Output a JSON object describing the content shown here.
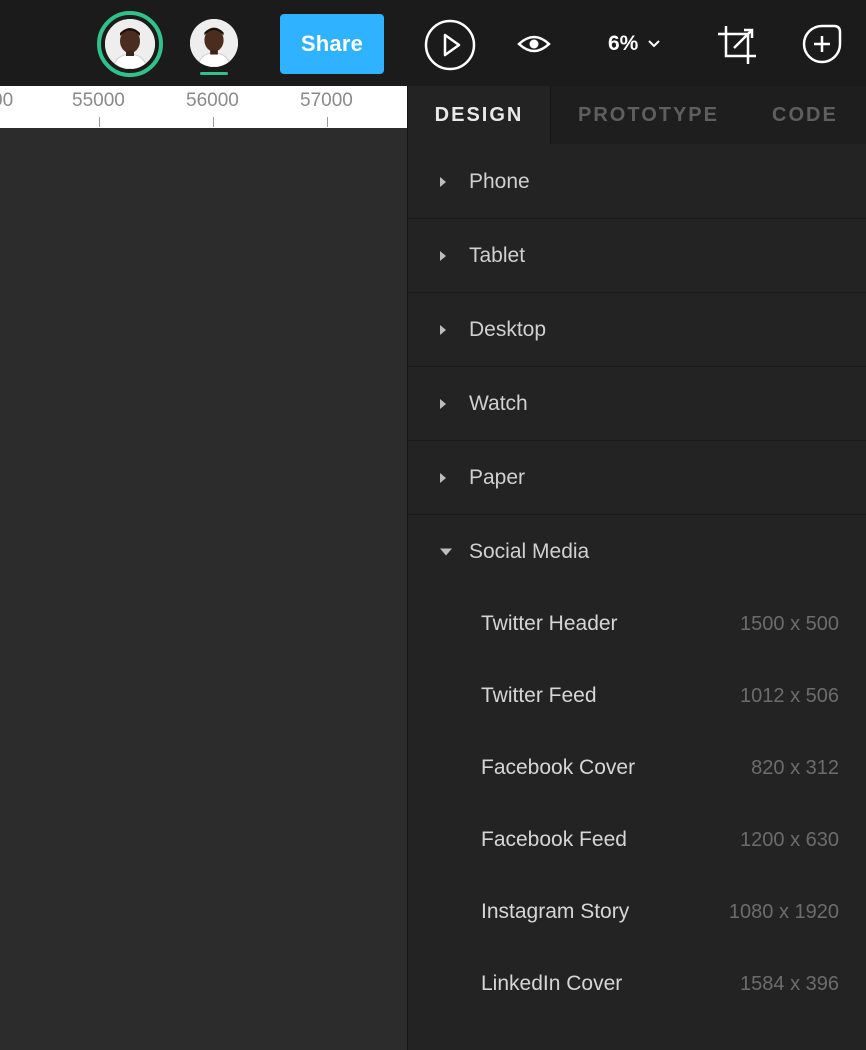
{
  "toolbar": {
    "share_label": "Share",
    "zoom_value": "6%",
    "accent_color": "#2fb2ff",
    "presence_color": "#2fc38b",
    "icons": [
      "user-avatar",
      "play-icon",
      "eye-icon",
      "chevron-down-icon",
      "crop-export-icon",
      "plus-circle-icon"
    ]
  },
  "ruler": {
    "partial_label": "00",
    "labels": [
      "55000",
      "56000",
      "57000"
    ]
  },
  "panel": {
    "tabs": [
      {
        "label": "DESIGN",
        "active": true
      },
      {
        "label": "PROTOTYPE",
        "active": false
      },
      {
        "label": "CODE",
        "active": false
      }
    ],
    "sections": [
      {
        "label": "Phone",
        "expanded": false
      },
      {
        "label": "Tablet",
        "expanded": false
      },
      {
        "label": "Desktop",
        "expanded": false
      },
      {
        "label": "Watch",
        "expanded": false
      },
      {
        "label": "Paper",
        "expanded": false
      },
      {
        "label": "Social Media",
        "expanded": true
      }
    ],
    "social_presets": [
      {
        "name": "Twitter Header",
        "size": "1500 x 500"
      },
      {
        "name": "Twitter Feed",
        "size": "1012 x 506"
      },
      {
        "name": "Facebook Cover",
        "size": "820 x 312"
      },
      {
        "name": "Facebook Feed",
        "size": "1200 x 630"
      },
      {
        "name": "Instagram Story",
        "size": "1080 x 1920"
      },
      {
        "name": "LinkedIn Cover",
        "size": "1584 x 396"
      }
    ]
  }
}
